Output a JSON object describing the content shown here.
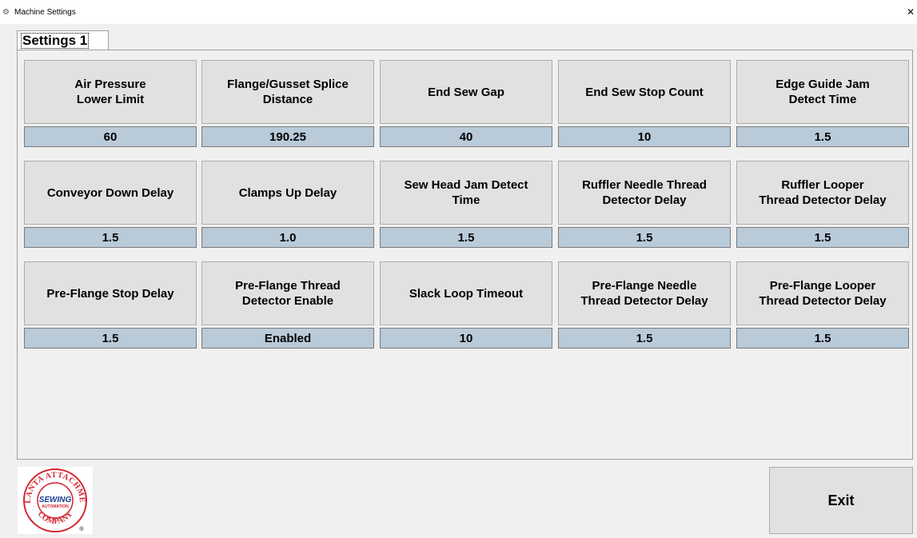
{
  "window": {
    "title": "Machine Settings",
    "icon": "machine-icon",
    "close_glyph": "✕"
  },
  "tab": {
    "label": "Settings 1"
  },
  "settings": [
    {
      "label": "Air Pressure\nLower Limit",
      "value": "60"
    },
    {
      "label": "Flange/Gusset Splice\nDistance",
      "value": "190.25"
    },
    {
      "label": "End Sew Gap",
      "value": "40"
    },
    {
      "label": "End Sew Stop Count",
      "value": "10"
    },
    {
      "label": "Edge Guide Jam\nDetect Time",
      "value": "1.5"
    },
    {
      "label": "Conveyor Down Delay",
      "value": "1.5"
    },
    {
      "label": "Clamps Up Delay",
      "value": "1.0"
    },
    {
      "label": "Sew Head Jam Detect\nTime",
      "value": "1.5"
    },
    {
      "label": "Ruffler Needle Thread\nDetector Delay",
      "value": "1.5"
    },
    {
      "label": "Ruffler Looper\nThread Detector Delay",
      "value": "1.5"
    },
    {
      "label": "Pre-Flange Stop Delay",
      "value": "1.5"
    },
    {
      "label": "Pre-Flange Thread\nDetector Enable",
      "value": "Enabled"
    },
    {
      "label": "Slack Loop Timeout",
      "value": "10"
    },
    {
      "label": "Pre-Flange Needle\nThread Detector Delay",
      "value": "1.5"
    },
    {
      "label": "Pre-Flange Looper\nThread Detector Delay",
      "value": "1.5"
    }
  ],
  "logo": {
    "arc_top": "ATLANTA ATTACHMENT",
    "center_line1": "SEWING",
    "center_line2": "AUTOMATION",
    "arc_bottom": "COMPANY",
    "registered": "®"
  },
  "exit_label": "Exit",
  "colors": {
    "button_bg": "#e1e1e1",
    "value_bg": "#b9cad9",
    "logo_red": "#d22630"
  }
}
